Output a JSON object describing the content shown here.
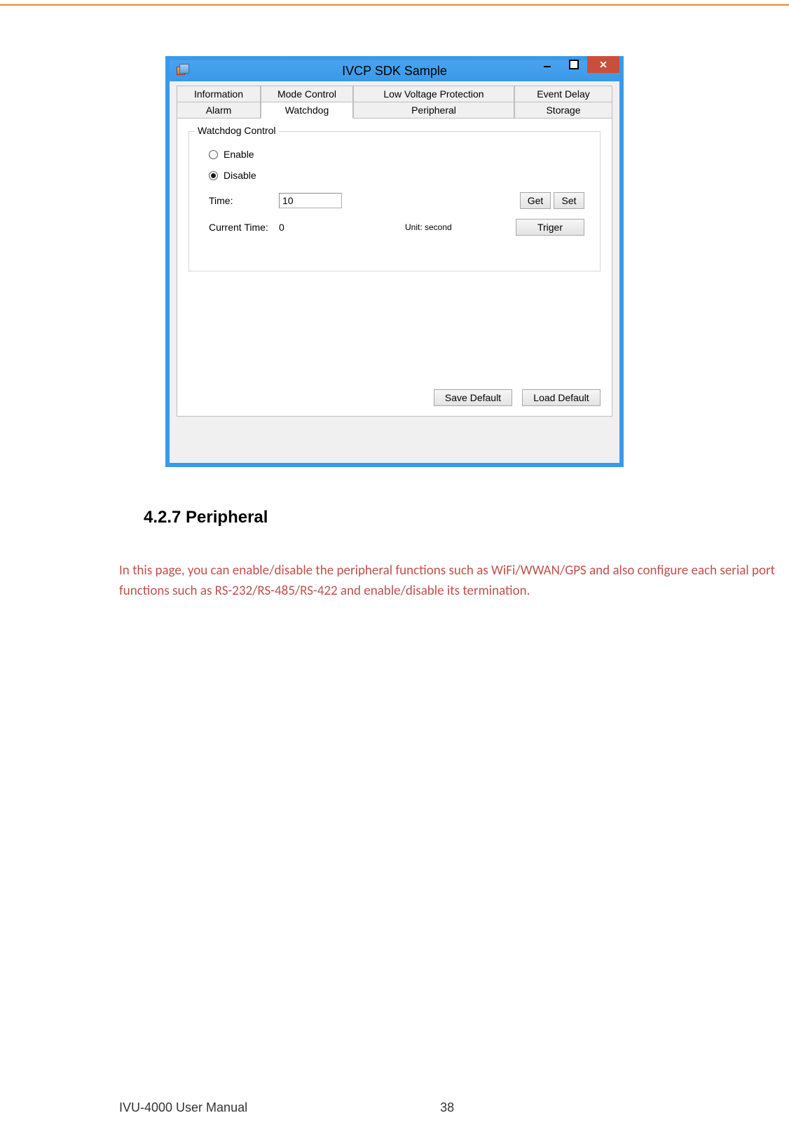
{
  "topbar_color": "#e98a2f",
  "window": {
    "title": "IVCP SDK Sample",
    "tabs_row1": [
      "Information",
      "Mode Control",
      "Low Voltage Protection",
      "Event Delay"
    ],
    "tabs_row2": [
      "Alarm",
      "Watchdog",
      "Peripheral",
      "Storage"
    ],
    "active_tab": "Watchdog"
  },
  "watchdog": {
    "group_label": "Watchdog Control",
    "radio_enable": "Enable",
    "radio_disable": "Disable",
    "radio_selected": "Disable",
    "time_label": "Time:",
    "time_value": "10",
    "current_time_label": "Current Time:",
    "current_time_value": "0",
    "unit_label": "Unit: second",
    "btn_get": "Get",
    "btn_set": "Set",
    "btn_triger": "Triger"
  },
  "buttons": {
    "save_default": "Save Default",
    "load_default": "Load Default"
  },
  "section_heading": "4.2.7 Peripheral",
  "body_text": "In this page, you can enable/disable the peripheral functions such as WiFi/WWAN/GPS and also configure each serial port functions such as RS-232/RS-485/RS-422 and enable/disable its termination.",
  "footer": {
    "doc_title": "IVU-4000 User Manual",
    "page_number": "38"
  }
}
